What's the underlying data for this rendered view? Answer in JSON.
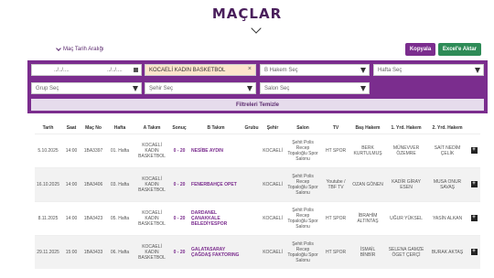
{
  "page": {
    "title": "MAÇLAR"
  },
  "filters": {
    "date_range_label": "Maç Tarih Aralığı",
    "date_start_placeholder": "../../....",
    "date_end_placeholder": "../../....",
    "team_selected": "KOCAELİ KADIN BASKETBOL",
    "team_clear": "×",
    "referee_placeholder": "B Hakem Seç",
    "week_placeholder": "Hafta Seç",
    "group_placeholder": "Grup Seç",
    "city_placeholder": "Şehir Seç",
    "hall_placeholder": "Salon Seç",
    "clear_label": "Filtreleri Temizle"
  },
  "toolbar": {
    "copy_label": "Kopyala",
    "excel_label": "Excel'e Aktar"
  },
  "table": {
    "headers": [
      "Tarih",
      "Saat",
      "Maç No",
      "Hafta",
      "A Takım",
      "Sonuç",
      "B Takım",
      "Grubu",
      "Şehir",
      "Salon",
      "TV",
      "Baş Hakem",
      "1. Yrd. Hakem",
      "2. Yrd. Hakem",
      ""
    ],
    "rows": [
      {
        "date": "5.10.2025",
        "time": "14:00",
        "match_no": "1BA3397",
        "week": "01. Hafta",
        "team_a": "KOCAELİ KADIN BASKETBOL",
        "score_a": "0",
        "score_b": "20",
        "team_b": "NESİBE AYDIN",
        "group": "",
        "city": "KOCAELİ",
        "hall": "Şehit Polis Recep Topaloğlu Spor Salonu",
        "tv": "HT SPOR",
        "head_ref": "BERK KURTULMUŞ",
        "ref1": "MÜNEVVER ÖZEMRE",
        "ref2": "SAİT NEDİM ÇELİK",
        "expand": "+"
      },
      {
        "date": "16.10.2025",
        "time": "14:00",
        "match_no": "1BA3406",
        "week": "03. Hafta",
        "team_a": "KOCAELİ KADIN BASKETBOL",
        "score_a": "0",
        "score_b": "20",
        "team_b": "FENERBAHÇE OPET",
        "group": "",
        "city": "KOCAELİ",
        "hall": "Şehit Polis Recep Topaloğlu Spor Salonu",
        "tv": "Youtube / TBF TV",
        "head_ref": "OZAN GÖNEN",
        "ref1": "KADİR GİRAY ESEN",
        "ref2": "MUSA ONUR SAVAŞ",
        "expand": "+"
      },
      {
        "date": "8.11.2025",
        "time": "14:00",
        "match_no": "1BA3423",
        "week": "05. Hafta",
        "team_a": "KOCAELİ KADIN BASKETBOL",
        "score_a": "0",
        "score_b": "20",
        "team_b": "DARDANEL ÇANAKKALE BELEDİYESPOR",
        "group": "",
        "city": "KOCAELİ",
        "hall": "Şehit Polis Recep Topaloğlu Spor Salonu",
        "tv": "HT SPOR",
        "head_ref": "İBRAHİM ALTINTAŞ",
        "ref1": "UĞUR YÜKSEL",
        "ref2": "YASİN ALKAN",
        "expand": "+"
      },
      {
        "date": "29.11.2025",
        "time": "15:00",
        "match_no": "1BA3433",
        "week": "06. Hafta",
        "team_a": "KOCAELİ KADIN BASKETBOL",
        "score_a": "0",
        "score_b": "20",
        "team_b": "GALATASARAY ÇAĞDAŞ FAKTORING",
        "group": "",
        "city": "KOCAELİ",
        "hall": "Şehit Polis Recep Topaloğlu Spor Salonu",
        "tv": "HT SPOR",
        "head_ref": "İSMAİL BİNBİR",
        "ref1": "SELENA GAMZE ÖGET ÇERÇİ",
        "ref2": "BURAK AKTAŞ",
        "expand": "+"
      }
    ]
  },
  "colors": {
    "primary": "#7b2d8e",
    "excel": "#2e8b57",
    "selected_bg": "#fde5cc"
  }
}
